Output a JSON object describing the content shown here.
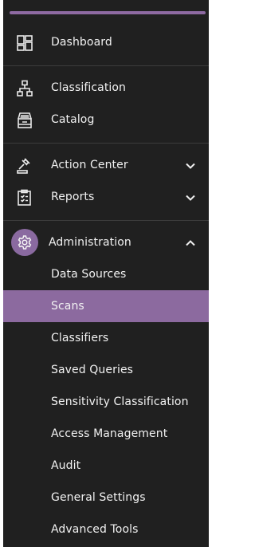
{
  "colors": {
    "sidebar_bg": "#202020",
    "accent": "#8c6a9f",
    "divider": "#3c3c3c",
    "text": "#f2f2f2"
  },
  "nav": {
    "dashboard": {
      "label": "Dashboard",
      "icon": "dashboard-icon"
    },
    "classification": {
      "label": "Classification",
      "icon": "hierarchy-icon"
    },
    "catalog": {
      "label": "Catalog",
      "icon": "cabinet-icon"
    },
    "action_center": {
      "label": "Action Center",
      "icon": "gavel-icon",
      "expanded": false
    },
    "reports": {
      "label": "Reports",
      "icon": "clipboard-icon",
      "expanded": false
    },
    "administration": {
      "label": "Administration",
      "icon": "gear-icon",
      "expanded": true,
      "items": [
        {
          "label": "Data Sources",
          "active": false
        },
        {
          "label": "Scans",
          "active": true
        },
        {
          "label": "Classifiers",
          "active": false
        },
        {
          "label": "Saved Queries",
          "active": false
        },
        {
          "label": "Sensitivity Classification",
          "active": false
        },
        {
          "label": "Access Management",
          "active": false
        },
        {
          "label": "Audit",
          "active": false
        },
        {
          "label": "General Settings",
          "active": false
        },
        {
          "label": "Advanced Tools",
          "active": false
        }
      ]
    }
  }
}
